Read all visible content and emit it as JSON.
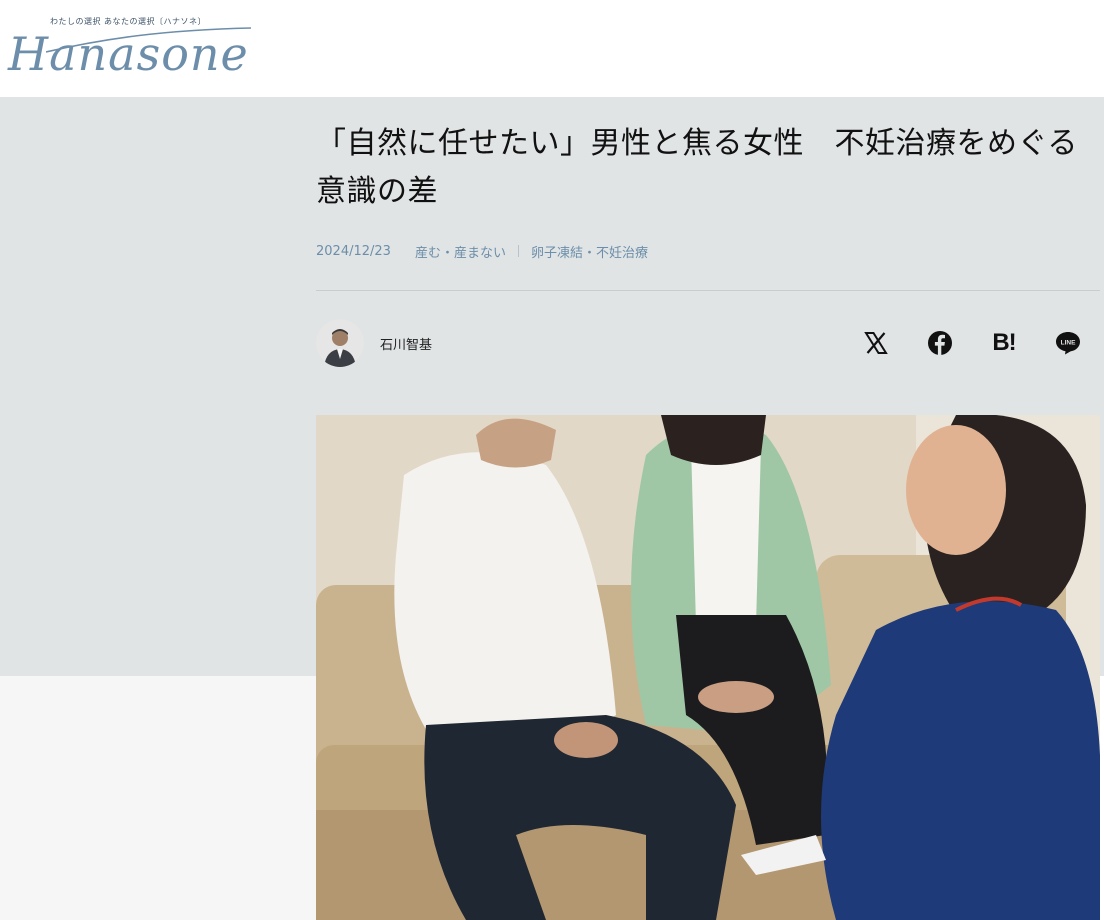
{
  "header": {
    "logo_tagline": "わたしの選択 あなたの選択〔ハナソネ〕",
    "logo_word": "Hanasone"
  },
  "article": {
    "title": "「自然に任せたい」男性と焦る女性　不妊治療をめぐる意識の差",
    "date": "2024/12/23",
    "categories": [
      "産む・産まない",
      "卵子凍結・不妊治療"
    ],
    "author": "石川智基"
  },
  "share": {
    "icons": [
      "x-icon",
      "facebook-icon",
      "hatena-bookmark-icon",
      "line-icon"
    ],
    "hatena_label": "B!",
    "line_label": "LINE"
  },
  "colors": {
    "band": "#e1e4e5",
    "accent": "#6c8eaa",
    "text": "#111111"
  }
}
